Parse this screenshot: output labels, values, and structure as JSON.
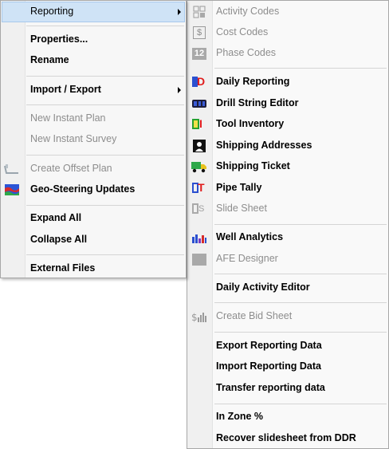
{
  "main_menu": {
    "items": [
      {
        "label": "Reporting",
        "has_submenu": true,
        "highlighted": true
      },
      {
        "label": "Properties..."
      },
      {
        "label": "Rename"
      },
      {
        "label": "Import / Export",
        "has_submenu": true
      },
      {
        "label": "New Instant Plan",
        "disabled": true
      },
      {
        "label": "New Instant Survey",
        "disabled": true
      },
      {
        "label": "Create Offset Plan",
        "disabled": true,
        "icon": "offset-plan-icon"
      },
      {
        "label": "Geo-Steering Updates",
        "icon": "geo-steering-icon"
      },
      {
        "label": "Expand All"
      },
      {
        "label": "Collapse All"
      },
      {
        "label": "External Files"
      }
    ]
  },
  "reporting_submenu": {
    "items": [
      {
        "label": "Activity Codes",
        "disabled": true,
        "icon": "activity-codes-icon"
      },
      {
        "label": "Cost Codes",
        "disabled": true,
        "icon": "cost-codes-icon"
      },
      {
        "label": "Phase Codes",
        "disabled": true,
        "icon": "phase-codes-icon"
      },
      {
        "label": "Daily Reporting",
        "icon": "daily-reporting-icon"
      },
      {
        "label": "Drill String Editor",
        "icon": "drill-string-icon"
      },
      {
        "label": "Tool Inventory",
        "icon": "tool-inventory-icon"
      },
      {
        "label": "Shipping Addresses",
        "icon": "shipping-addresses-icon"
      },
      {
        "label": "Shipping Ticket",
        "icon": "shipping-ticket-icon"
      },
      {
        "label": "Pipe Tally",
        "icon": "pipe-tally-icon"
      },
      {
        "label": "Slide Sheet",
        "disabled": true,
        "icon": "slide-sheet-icon"
      },
      {
        "label": "Well Analytics",
        "icon": "well-analytics-icon"
      },
      {
        "label": "AFE Designer",
        "disabled": true,
        "icon": "afe-designer-icon"
      },
      {
        "label": "Daily Activity Editor"
      },
      {
        "label": "Create Bid Sheet",
        "disabled": true,
        "icon": "bid-sheet-icon"
      },
      {
        "label": "Export Reporting Data"
      },
      {
        "label": "Import Reporting Data"
      },
      {
        "label": "Transfer reporting data"
      },
      {
        "label": "In Zone %"
      },
      {
        "label": "Recover slidesheet from DDR"
      }
    ]
  },
  "icon_glyphs": {
    "cost_codes": "$",
    "phase_codes": "12",
    "daily_reporting": "D",
    "tool_inventory": "I",
    "pipe_tally": "T",
    "slide_sheet": "S"
  },
  "colors": {
    "highlight_bg": "#cfe3f6",
    "highlight_border": "#a8c9ec",
    "disabled_text": "#8d8d8d",
    "separator": "#d5d5d5"
  }
}
